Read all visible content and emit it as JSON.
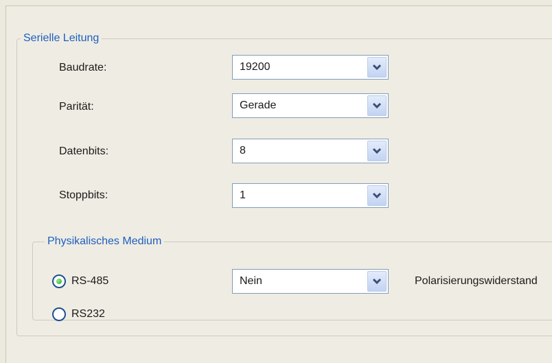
{
  "serial_line": {
    "legend": "Serielle Leitung",
    "fields": [
      {
        "label": "Baudrate:",
        "value": "19200"
      },
      {
        "label": "Parität:",
        "value": "Gerade"
      },
      {
        "label": "Datenbits:",
        "value": "8"
      },
      {
        "label": "Stoppbits:",
        "value": "1"
      }
    ]
  },
  "physical_medium": {
    "legend": "Physikalisches Medium",
    "options": [
      {
        "label": "RS-485",
        "selected": true
      },
      {
        "label": "RS232",
        "selected": false
      }
    ],
    "polarization": {
      "value": "Nein",
      "label": "Polarisierungswiderstand"
    }
  },
  "icons": {
    "dropdown": "chevron-down-icon",
    "radio": "radio-icon"
  },
  "colors": {
    "legend_text": "#1d5fbf",
    "combo_border": "#7f9db9",
    "radio_selected": "#20a820"
  }
}
